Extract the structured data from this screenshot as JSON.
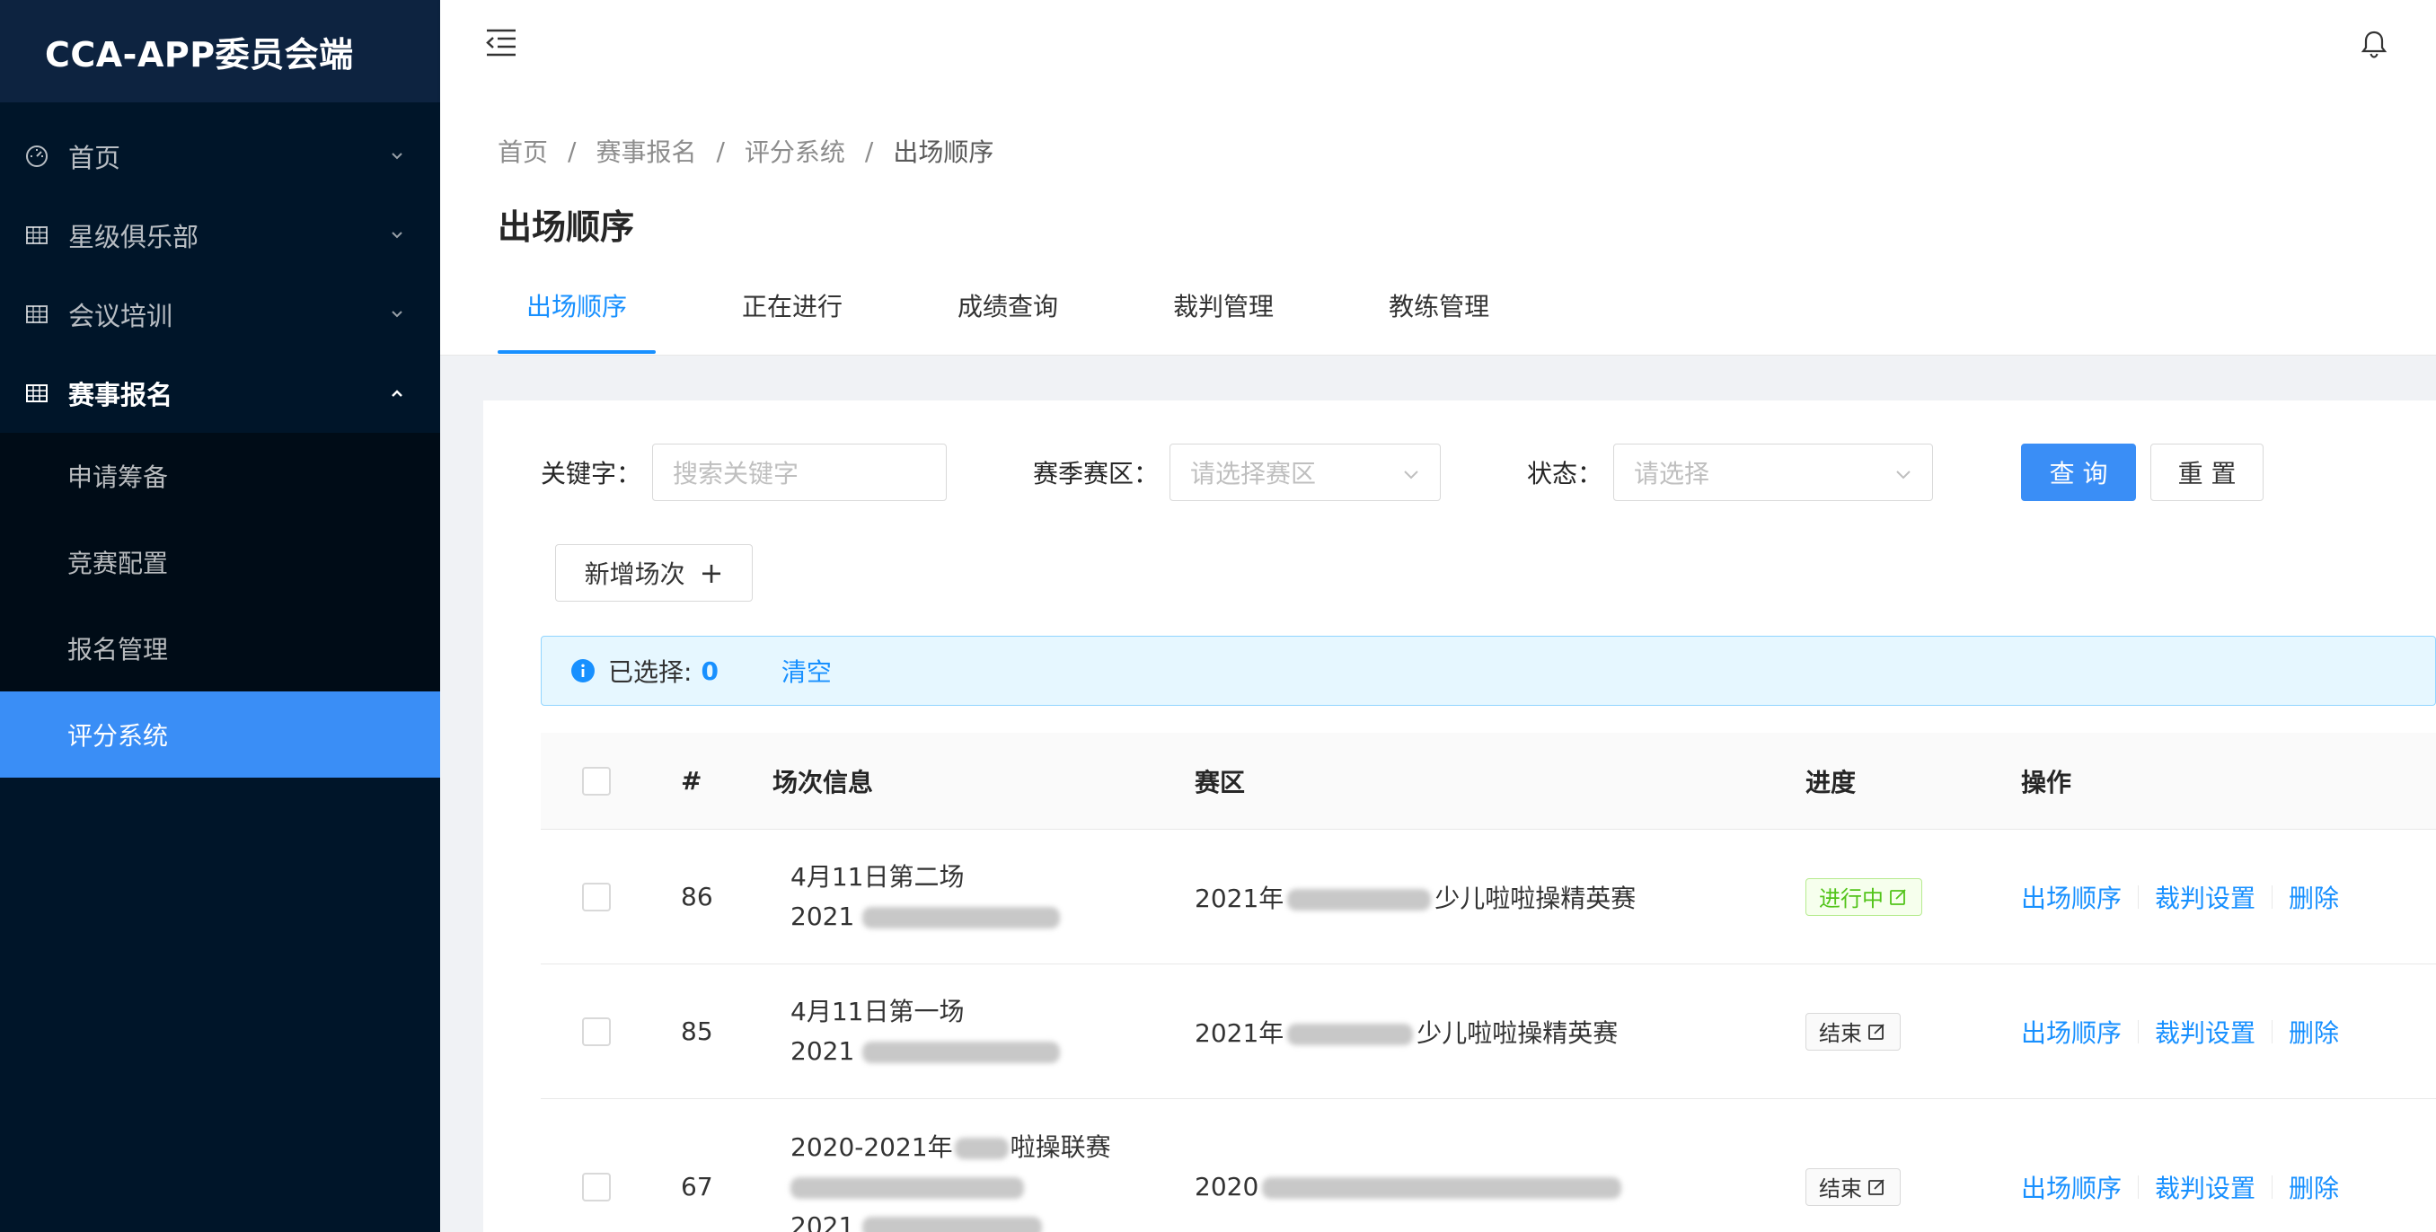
{
  "app": {
    "title": "CCA-APP委员会端"
  },
  "sidebar": {
    "items": [
      {
        "label": "首页",
        "icon": "dashboard-icon",
        "expanded": false
      },
      {
        "label": "星级俱乐部",
        "icon": "table-icon",
        "expanded": false
      },
      {
        "label": "会议培训",
        "icon": "table-icon",
        "expanded": false
      },
      {
        "label": "赛事报名",
        "icon": "table-icon",
        "expanded": true
      }
    ],
    "subitems": [
      {
        "label": "申请筹备"
      },
      {
        "label": "竞赛配置"
      },
      {
        "label": "报名管理"
      },
      {
        "label": "评分系统",
        "active": true
      }
    ]
  },
  "breadcrumb": [
    "首页",
    "赛事报名",
    "评分系统",
    "出场顺序"
  ],
  "breadcrumb_sep": "/",
  "page": {
    "title": "出场顺序"
  },
  "tabs": [
    {
      "label": "出场顺序",
      "active": true
    },
    {
      "label": "正在进行"
    },
    {
      "label": "成绩查询"
    },
    {
      "label": "裁判管理"
    },
    {
      "label": "教练管理"
    }
  ],
  "filters": {
    "keyword_label": "关键字：",
    "keyword_placeholder": "搜索关键字",
    "region_label": "赛季赛区：",
    "region_placeholder": "请选择赛区",
    "status_label": "状态：",
    "status_placeholder": "请选择",
    "query_button": "查 询",
    "reset_button": "重 置"
  },
  "add_button": "新增场次",
  "selection": {
    "label": "已选择:",
    "count": "0",
    "clear": "清空"
  },
  "table": {
    "headers": {
      "num": "#",
      "info": "场次信息",
      "region": "赛区",
      "progress": "进度",
      "ops": "操作"
    },
    "rows": [
      {
        "num": "86",
        "info1": "4月11日第二场",
        "info2_prefix": "2021",
        "region_prefix": "2021年",
        "region_suffix": "少儿啦啦操精英赛",
        "status": "进行中",
        "status_type": "green"
      },
      {
        "num": "85",
        "info1": "4月11日第一场",
        "info2_prefix": "2021",
        "region_prefix": "2021年",
        "region_suffix": "少儿啦啦操精英赛",
        "status": "结束",
        "status_type": "gray"
      },
      {
        "num": "67",
        "info1": "2020-2021年",
        "info1_suffix": "啦操联赛",
        "info2_prefix": "2021",
        "region_prefix": "2020",
        "region_suffix": "",
        "status": "结束",
        "status_type": "gray"
      }
    ],
    "ops": {
      "order": "出场顺序",
      "judge": "裁判设置",
      "delete": "删除"
    }
  },
  "colors": {
    "sidebar": "#001529",
    "accent": "#3a8ef6",
    "link": "#1890ff"
  }
}
